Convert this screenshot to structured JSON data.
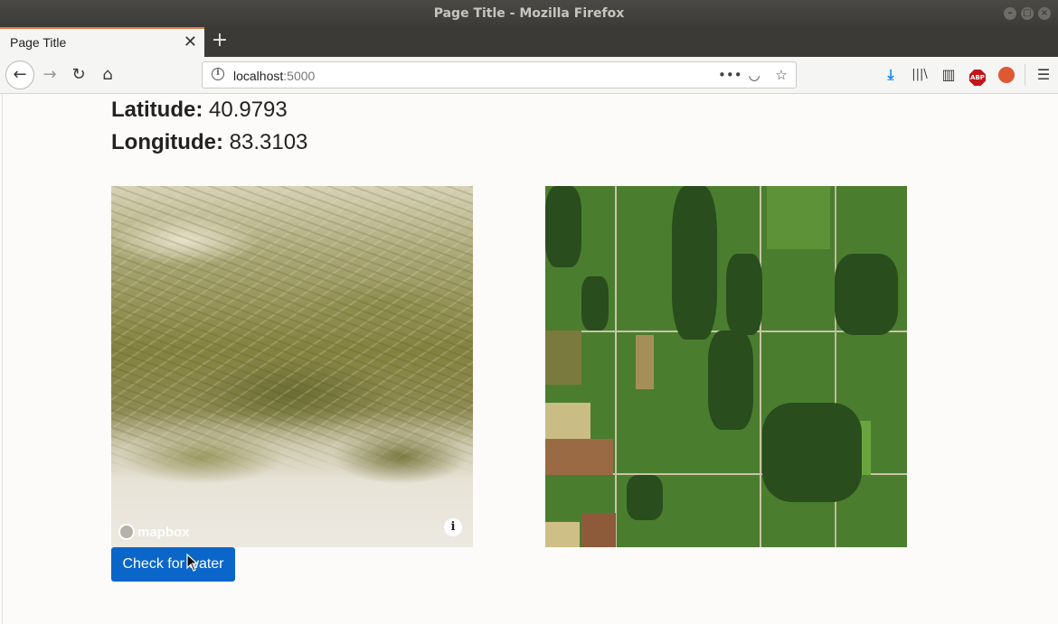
{
  "window": {
    "title": "Page Title - Mozilla Firefox"
  },
  "tab": {
    "title": "Page Title",
    "close_glyph": "✕",
    "new_tab_glyph": "+"
  },
  "navbar": {
    "back_glyph": "←",
    "forward_glyph": "→",
    "reload_glyph": "↻",
    "home_glyph": "⌂",
    "url_host": "localhost",
    "url_port": ":5000",
    "page_actions_glyph": "•••",
    "pocket_glyph": "◡",
    "bookmark_glyph": "☆",
    "download_glyph": "⤓",
    "library_glyph": "|||\\",
    "sidebar_glyph": "▥",
    "abp_label": "ABP",
    "menu_glyph": "☰"
  },
  "coordinates": {
    "latitude_label": "Latitude:",
    "latitude_value": "40.9793",
    "longitude_label": "Longitude:",
    "longitude_value": "83.3103"
  },
  "map": {
    "logo_text": "mapbox",
    "attribution_glyph": "i"
  },
  "actions": {
    "check_button_label": "Check for water"
  },
  "colors": {
    "accent_tab": "#e8774a",
    "button_bg": "#0a66c9",
    "download_blue": "#0a84ff"
  }
}
